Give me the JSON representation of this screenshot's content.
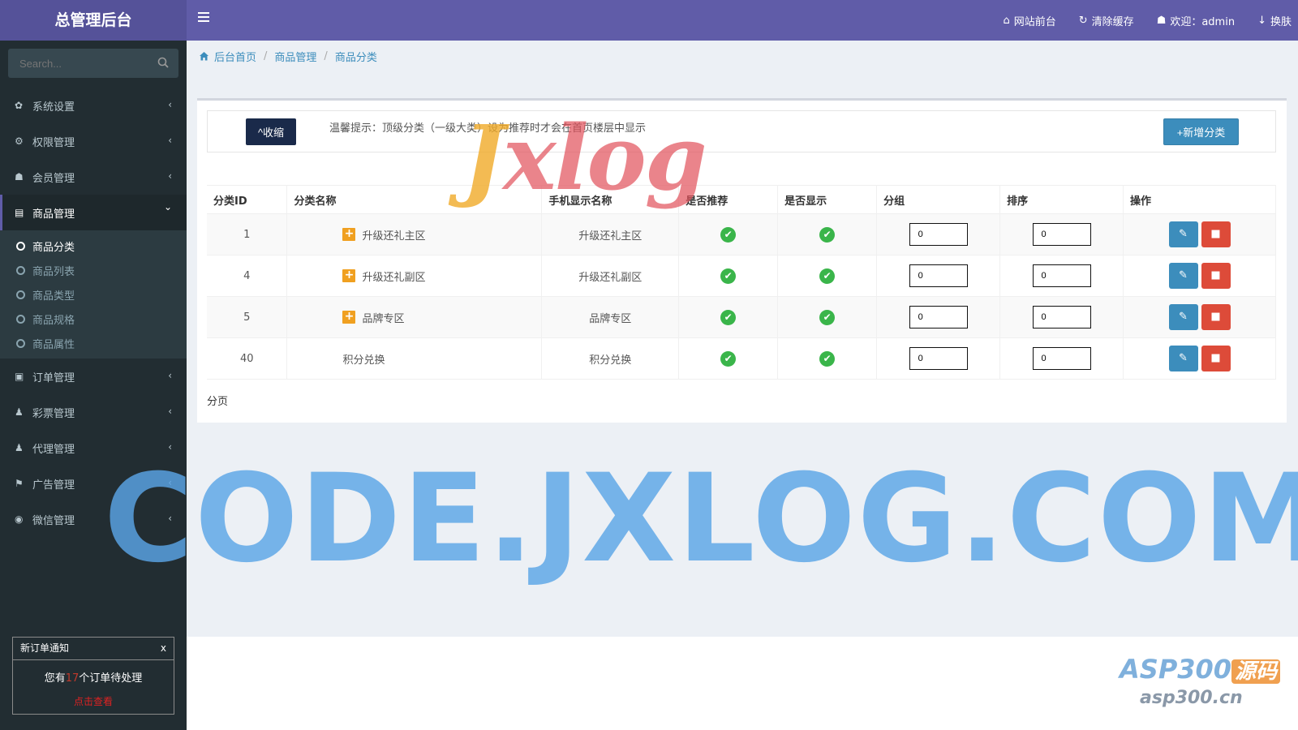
{
  "header": {
    "logo": "总管理后台",
    "nav": [
      {
        "icon": "home-icon",
        "glyph": "⌂",
        "label": "网站前台"
      },
      {
        "icon": "refresh-icon",
        "glyph": "↻",
        "label": "清除缓存"
      },
      {
        "icon": "user-icon",
        "glyph": "☗",
        "label": "欢迎：admin"
      },
      {
        "icon": "skin-icon",
        "glyph": "↓",
        "label": "换肤"
      }
    ]
  },
  "sidebar": {
    "search_placeholder": "Search...",
    "items": [
      {
        "icon": "gear-icon",
        "glyph": "✿",
        "label": "系统设置"
      },
      {
        "icon": "gears-icon",
        "glyph": "⚙",
        "label": "权限管理"
      },
      {
        "icon": "user-icon",
        "glyph": "☗",
        "label": "会员管理"
      },
      {
        "icon": "book-icon",
        "glyph": "▤",
        "label": "商品管理"
      },
      {
        "icon": "money-icon",
        "glyph": "▣",
        "label": "订单管理"
      },
      {
        "icon": "bell-icon",
        "glyph": "♟",
        "label": "彩票管理"
      },
      {
        "icon": "bell-icon",
        "glyph": "♟",
        "label": "代理管理"
      },
      {
        "icon": "flag-icon",
        "glyph": "⚑",
        "label": "广告管理"
      },
      {
        "icon": "wechat-icon",
        "glyph": "◉",
        "label": "微信管理"
      }
    ],
    "submenu": [
      "商品分类",
      "商品列表",
      "商品类型",
      "商品规格",
      "商品属性"
    ],
    "chevron_left": "‹",
    "chevron_down": "⌄"
  },
  "notice": {
    "title": "新订单通知",
    "close": "x",
    "pre": "您有",
    "count": "17",
    "post": "个订单待处理",
    "link": "点击查看"
  },
  "breadcrumb": [
    "后台首页",
    "商品管理",
    "商品分类"
  ],
  "toolbar": {
    "collapse": "^收缩",
    "tip": "温馨提示：顶级分类（一级大类）设为推荐时才会在首页楼层中显示",
    "add": "+新增分类"
  },
  "table": {
    "headers": [
      "分类ID",
      "分类名称",
      "手机显示名称",
      "是否推荐",
      "是否显示",
      "分组",
      "排序",
      "操作"
    ],
    "rows": [
      {
        "id": "1",
        "name": "升级还礼主区",
        "mobile": "升级还礼主区",
        "group": "0",
        "sort": "0"
      },
      {
        "id": "4",
        "name": "升级还礼副区",
        "mobile": "升级还礼副区",
        "group": "0",
        "sort": "0"
      },
      {
        "id": "5",
        "name": "品牌专区",
        "mobile": "品牌专区",
        "group": "0",
        "sort": "0"
      },
      {
        "id": "40",
        "name": "积分兑换",
        "mobile": "积分兑换",
        "group": "0",
        "sort": "0"
      }
    ],
    "check": "✔",
    "edit_glyph": "✎",
    "delete_glyph": "■"
  },
  "pager": "分页",
  "watermarks": {
    "logo_j": "J",
    "logo_rest": "xlog",
    "big": "CODE.JXLOG.COM",
    "asp": "ASP300",
    "asp_src": "源码",
    "url": "asp300.cn"
  },
  "colors": {
    "header": "#605ca8",
    "sidebar": "#222d32",
    "primary": "#3c8dbc",
    "danger": "#dd4b39",
    "success": "#3ab54a"
  }
}
